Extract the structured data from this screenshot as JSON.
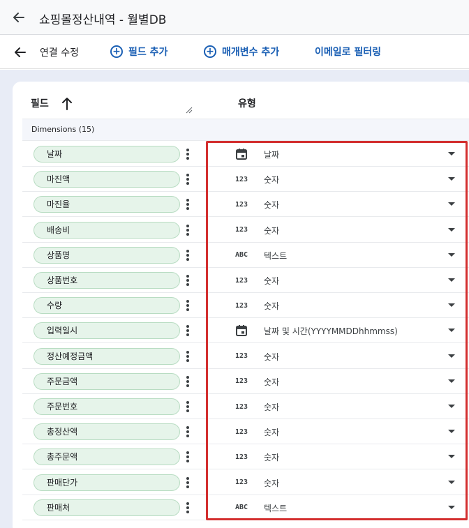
{
  "window": {
    "title": "쇼핑몰정산내역 - 월별DB"
  },
  "toolbar": {
    "edit_label": "연결 수정",
    "add_field": "필드 추가",
    "add_parameter": "매개변수 추가",
    "filter_by_email": "이메일로 필터링"
  },
  "table": {
    "header_field": "필드",
    "header_type": "유형",
    "group_label": "Dimensions (15)",
    "rows": [
      {
        "field": "날짜",
        "type_icon": "calendar-icon",
        "type": "날짜"
      },
      {
        "field": "마진액",
        "type_icon": "123",
        "type": "숫자"
      },
      {
        "field": "마진율",
        "type_icon": "123",
        "type": "숫자"
      },
      {
        "field": "배송비",
        "type_icon": "123",
        "type": "숫자"
      },
      {
        "field": "상품명",
        "type_icon": "ABC",
        "type": "텍스트"
      },
      {
        "field": "상품번호",
        "type_icon": "123",
        "type": "숫자"
      },
      {
        "field": "수량",
        "type_icon": "123",
        "type": "숫자"
      },
      {
        "field": "입력일시",
        "type_icon": "calendar-icon",
        "type": "날짜 및 시간(YYYYMMDDhhmmss)"
      },
      {
        "field": "정산예정금액",
        "type_icon": "123",
        "type": "숫자"
      },
      {
        "field": "주문금액",
        "type_icon": "123",
        "type": "숫자"
      },
      {
        "field": "주문번호",
        "type_icon": "123",
        "type": "숫자"
      },
      {
        "field": "총정산액",
        "type_icon": "123",
        "type": "숫자"
      },
      {
        "field": "총주문액",
        "type_icon": "123",
        "type": "숫자"
      },
      {
        "field": "판매단가",
        "type_icon": "123",
        "type": "숫자"
      },
      {
        "field": "판매처",
        "type_icon": "ABC",
        "type": "텍스트"
      }
    ]
  },
  "colors": {
    "accent": "#1a5fb4",
    "chip_bg": "#e6f4ea",
    "chip_border": "#b8dcc2",
    "highlight_border": "#d32f2f",
    "page_bg": "#e8ecf6"
  }
}
